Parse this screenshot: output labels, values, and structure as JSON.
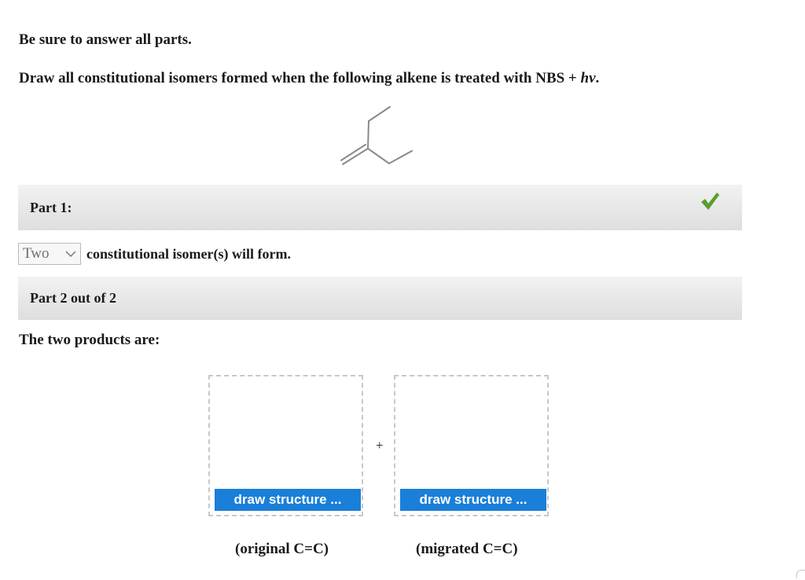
{
  "instruction": "Be sure to answer all parts.",
  "question": {
    "text": "Draw all constitutional isomers formed when the following alkene is treated with NBS + ",
    "hv": "hv",
    "end": "."
  },
  "part1": {
    "label": "Part 1:",
    "status_icon": "checkmark-icon",
    "status_color": "#5a9e2f",
    "selected_count": "Two",
    "sentence": "constitutional isomer(s) will form."
  },
  "part2": {
    "label": "Part 2 out of 2",
    "products_label": "The two products are:",
    "plus": "+",
    "box1": {
      "button": "draw structure ...",
      "caption": "(original C=C)"
    },
    "box2": {
      "button": "draw structure ...",
      "caption": "(migrated C=C)"
    }
  },
  "colors": {
    "button_blue": "#1a7fd9",
    "bar_gray": "#e6e6e6"
  }
}
